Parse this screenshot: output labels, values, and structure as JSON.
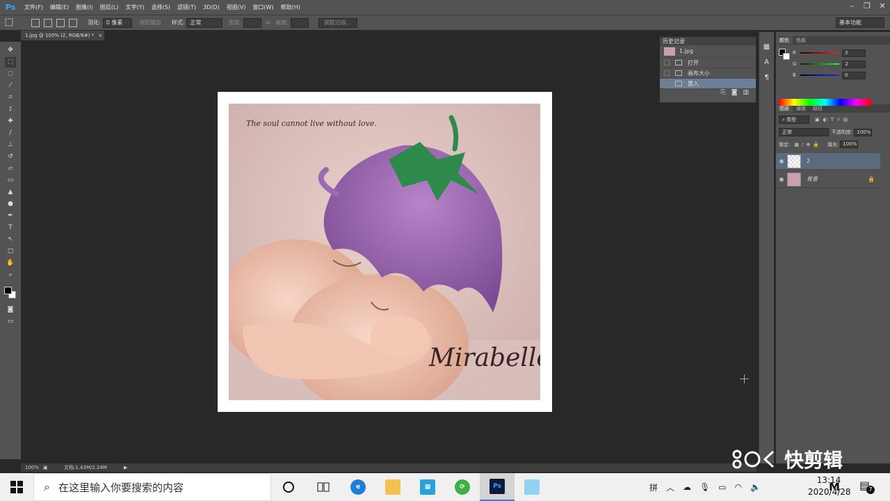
{
  "app": {
    "logo": "Ps"
  },
  "menu": [
    "文件(F)",
    "编辑(E)",
    "图像(I)",
    "图层(L)",
    "文字(Y)",
    "选择(S)",
    "滤镜(T)",
    "3D(D)",
    "视图(V)",
    "窗口(W)",
    "帮助(H)"
  ],
  "window_controls": [
    "–",
    "❐",
    "✕"
  ],
  "options": {
    "feather_label": "羽化:",
    "feather_value": "0 像素",
    "antialias_label": "消除锯齿",
    "style_label": "样式:",
    "style_value": "正常",
    "width_label": "宽度:",
    "height_label": "高度:",
    "refine_edge": "调整边缘...",
    "workspace": "基本功能"
  },
  "document": {
    "tab_title": "1.jpg @ 100% (2, RGB/8#) *",
    "zoom": "100%",
    "doc_size": "文档:1.43M/2.24M"
  },
  "photo": {
    "quote": "The soul cannot live without love.",
    "signature": "Mirabelle"
  },
  "history": {
    "title": "历史记录",
    "snapshot": "1.jpg",
    "items": [
      "打开",
      "画布大小",
      "置入"
    ]
  },
  "color_panel": {
    "tabs": [
      "颜色",
      "色板"
    ],
    "channels": [
      {
        "name": "R",
        "value": "3",
        "color": "#d02020"
      },
      {
        "name": "G",
        "value": "2",
        "color": "#20a020"
      },
      {
        "name": "B",
        "value": "0",
        "color": "#2040d0"
      }
    ]
  },
  "layers_panel": {
    "tabs": [
      "图层",
      "通道",
      "路径"
    ],
    "kind_filter": "类型",
    "blend_mode": "正常",
    "opacity_label": "不透明度:",
    "opacity_value": "100%",
    "lock_label": "锁定:",
    "fill_label": "填充:",
    "fill_value": "100%",
    "layers": [
      {
        "name": "2",
        "selected": true
      },
      {
        "name": "背景",
        "locked": true
      }
    ]
  },
  "taskbar": {
    "search_placeholder": "在这里输入你要搜索的内容",
    "time": "13:14",
    "date": "2020/4/28",
    "ime": "拼",
    "notifications": "7"
  },
  "watermark": {
    "text": "快剪辑"
  }
}
